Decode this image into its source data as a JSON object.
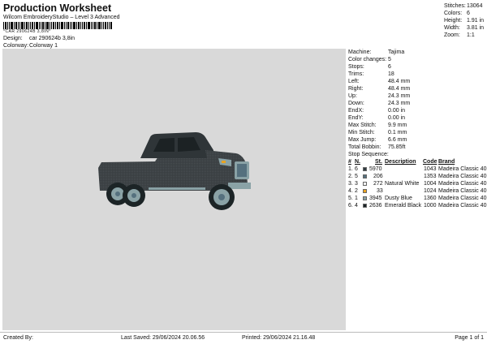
{
  "header": {
    "title": "Production Worksheet",
    "subtitle": "Wilcom EmbroideryStudio – Level 3 Advanced",
    "barcode_text": "*CAR 290624B 3,8IN*",
    "design_label": "Design:",
    "design_value": "car 290624b 3,8in",
    "colorway_label": "Colorway:",
    "colorway_value": "Colorway 1"
  },
  "summary": [
    {
      "label": "Stitches:",
      "value": "13064"
    },
    {
      "label": "Colors:",
      "value": "6"
    },
    {
      "label": "Height:",
      "value": "1.91 in"
    },
    {
      "label": "Width:",
      "value": "3.81 in"
    },
    {
      "label": "Zoom:",
      "value": "1:1"
    }
  ],
  "info": [
    {
      "label": "Machine:",
      "value": "Tajima"
    },
    {
      "label": "Color changes:",
      "value": "5"
    },
    {
      "label": "Stops:",
      "value": "6"
    },
    {
      "label": "Trims:",
      "value": "18"
    },
    {
      "label": "Left:",
      "value": "48.4 mm"
    },
    {
      "label": "Right:",
      "value": "48.4 mm"
    },
    {
      "label": "Up:",
      "value": "24.3 mm"
    },
    {
      "label": "Down:",
      "value": "24.3 mm"
    },
    {
      "label": "EndX:",
      "value": "0.00 in"
    },
    {
      "label": "EndY:",
      "value": "0.00 in"
    },
    {
      "label": "Max Stitch:",
      "value": "9.9 mm"
    },
    {
      "label": "Min Stitch:",
      "value": "0.1 mm"
    },
    {
      "label": "Max Jump:",
      "value": "6.6 mm"
    },
    {
      "label": "Total Bobbin:",
      "value": "75.85ft"
    }
  ],
  "stop_sequence": {
    "title": "Stop Sequence:",
    "headers": {
      "num": "#",
      "n": "N.",
      "st": "St.",
      "description": "Description",
      "code": "Code",
      "brand": "Brand"
    },
    "rows": [
      {
        "num": "1.",
        "n": "6",
        "color": "#2f3a40",
        "st": "5970",
        "description": "",
        "code": "1043",
        "brand": "Madeira Classic 40"
      },
      {
        "num": "2.",
        "n": "5",
        "color": "#55707e",
        "st": "206",
        "description": "",
        "code": "1353",
        "brand": "Madeira Classic 40"
      },
      {
        "num": "3.",
        "n": "3",
        "color": "#f5f5f5",
        "st": "272",
        "description": "Natural White",
        "code": "1004",
        "brand": "Madeira Classic 40"
      },
      {
        "num": "4.",
        "n": "2",
        "color": "#e8a320",
        "st": "33",
        "description": "",
        "code": "1024",
        "brand": "Madeira Classic 40"
      },
      {
        "num": "5.",
        "n": "1",
        "color": "#8aa2a6",
        "st": "3945",
        "description": "Dusty Blue",
        "code": "1360",
        "brand": "Madeira Classic 40"
      },
      {
        "num": "6.",
        "n": "4",
        "color": "#1c2426",
        "st": "2636",
        "description": "Emerald Black",
        "code": "1000",
        "brand": "Madeira Classic 40"
      }
    ]
  },
  "footer": {
    "created": "Created By:",
    "saved": "Last Saved: 29/06/2024 20.06.56",
    "printed": "Printed: 29/06/2024 21.16.48",
    "page": "Page 1 of 1"
  },
  "colors": {
    "preview_bg": "#d9d9d9",
    "truck_body": "#3a3f42",
    "truck_trim": "#8aa2a6"
  }
}
